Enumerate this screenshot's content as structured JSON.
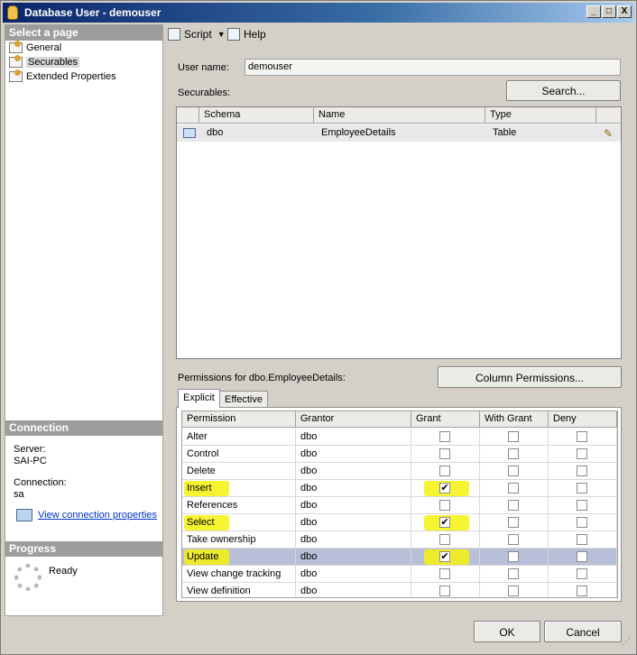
{
  "window": {
    "title": "Database User - demouser",
    "controls": [
      "_",
      "□",
      "X"
    ]
  },
  "sidebar": {
    "select_page_header": "Select a page",
    "pages": [
      {
        "label": "General",
        "icon": "property-page-icon"
      },
      {
        "label": "Securables",
        "icon": "property-page-icon"
      },
      {
        "label": "Extended Properties",
        "icon": "property-page-icon"
      }
    ],
    "connection_header": "Connection",
    "server_label": "Server:",
    "server_value": "SAI-PC",
    "connection_label": "Connection:",
    "connection_value": "sa",
    "view_connection_link": "View connection properties",
    "progress_header": "Progress",
    "progress_status": "Ready"
  },
  "toolbar": {
    "script_label": "Script",
    "help_label": "Help"
  },
  "user": {
    "username_label": "User name:",
    "username_value": "demouser",
    "securables_label": "Securables:",
    "search_button": "Search..."
  },
  "securables_grid": {
    "columns": [
      "Schema",
      "Name",
      "Type"
    ],
    "rows": [
      {
        "schema": "dbo",
        "name": "EmployeeDetails",
        "type": "Table"
      }
    ]
  },
  "permissions": {
    "label": "Permissions for dbo.EmployeeDetails:",
    "column_permissions_button": "Column Permissions...",
    "tabs": [
      "Explicit",
      "Effective"
    ],
    "columns": [
      "Permission",
      "Grantor",
      "Grant",
      "With Grant",
      "Deny"
    ],
    "rows": [
      {
        "permission": "Alter",
        "grantor": "dbo",
        "grant": false,
        "with_grant": false,
        "deny": false
      },
      {
        "permission": "Control",
        "grantor": "dbo",
        "grant": false,
        "with_grant": false,
        "deny": false
      },
      {
        "permission": "Delete",
        "grantor": "dbo",
        "grant": false,
        "with_grant": false,
        "deny": false
      },
      {
        "permission": "Insert",
        "grantor": "dbo",
        "grant": true,
        "with_grant": false,
        "deny": false
      },
      {
        "permission": "References",
        "grantor": "dbo",
        "grant": false,
        "with_grant": false,
        "deny": false
      },
      {
        "permission": "Select",
        "grantor": "dbo",
        "grant": true,
        "with_grant": false,
        "deny": false
      },
      {
        "permission": "Take ownership",
        "grantor": "dbo",
        "grant": false,
        "with_grant": false,
        "deny": false
      },
      {
        "permission": "Update",
        "grantor": "dbo",
        "grant": true,
        "with_grant": false,
        "deny": false
      },
      {
        "permission": "View change tracking",
        "grantor": "dbo",
        "grant": false,
        "with_grant": false,
        "deny": false
      },
      {
        "permission": "View definition",
        "grantor": "dbo",
        "grant": false,
        "with_grant": false,
        "deny": false
      }
    ],
    "selected_row": "Update",
    "highlight_color": "#f4f10c",
    "selection_color": "#b8bfd8"
  },
  "footer": {
    "ok_button": "OK",
    "cancel_button": "Cancel"
  },
  "colors": {
    "title_gradient_start": "#0a246a",
    "section_header": "#9d9d9d",
    "link": "#0033cc"
  }
}
